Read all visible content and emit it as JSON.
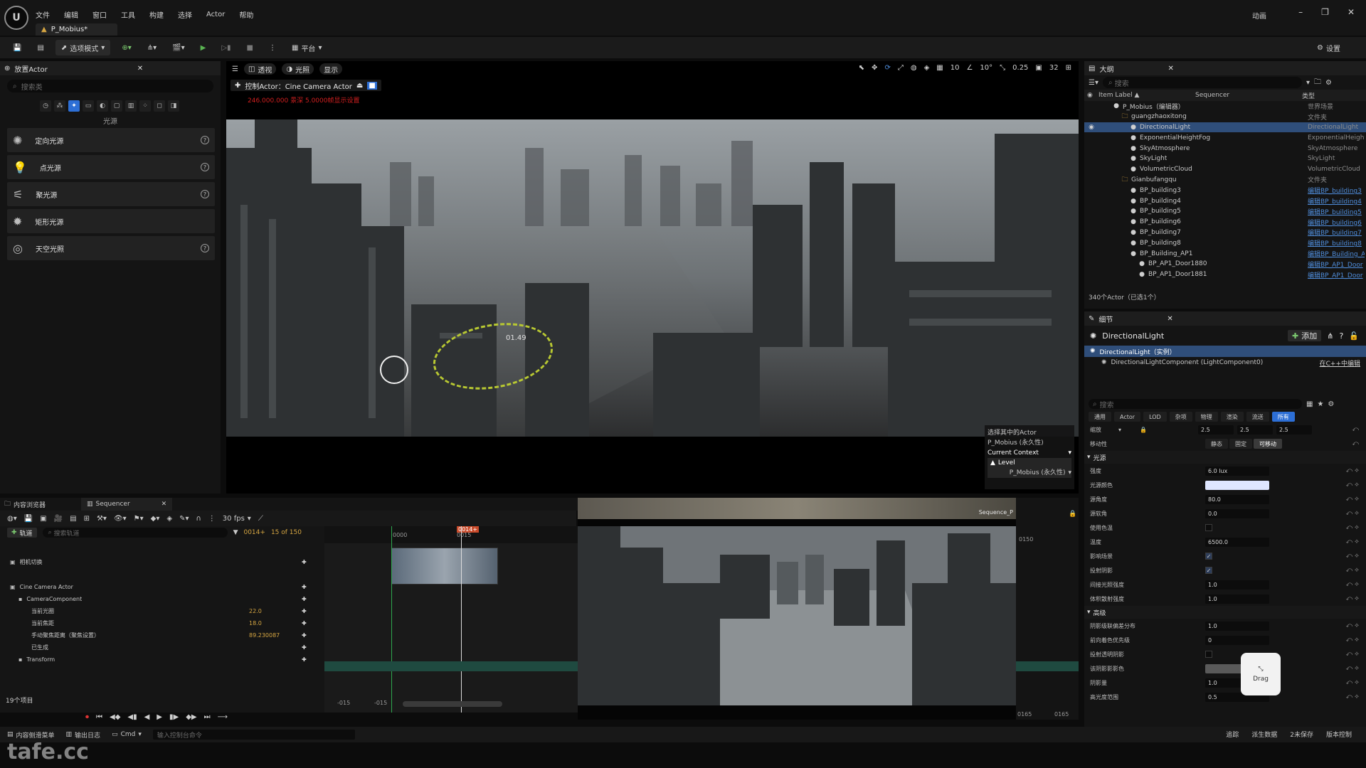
{
  "titlebar": {
    "menus": [
      "文件",
      "编辑",
      "窗口",
      "工具",
      "构建",
      "选择",
      "Actor",
      "帮助"
    ],
    "doc_tab": "P_Mobius*",
    "anim_label": "动画"
  },
  "toolbar": {
    "mode_label": "选项模式",
    "platform_label": "平台",
    "settings_label": "设置"
  },
  "place_actor": {
    "tab_label": "放置Actor",
    "search_placeholder": "搜索类",
    "category_label": "光源",
    "items": [
      {
        "label": "定向光源"
      },
      {
        "label": "点光源"
      },
      {
        "label": "聚光源"
      },
      {
        "label": "矩形光源"
      },
      {
        "label": "天空光照"
      }
    ]
  },
  "viewport": {
    "pills": [
      "透视",
      "光照",
      "显示"
    ],
    "grid_snap": "10",
    "rot_snap": "10°",
    "scale_snap": "0.25",
    "cam_speed": "32",
    "pilot_label": "控制Actor：Cine Camera Actor",
    "pilot_warning": "246.000.000 景深  5.0000帧显示设置",
    "fov_readout": "01.49",
    "context": {
      "title": "选择其中的Actor",
      "actor": "P_Mobius (永久性)",
      "section": "Current Context",
      "level_label": "Level",
      "level_value": "P_Mobius (永久性)"
    }
  },
  "outliner": {
    "tab_label": "大纲",
    "search_placeholder": "搜索",
    "col_label": "Item Label ▲",
    "col_sequencer": "Sequencer",
    "col_type": "类型",
    "rows": [
      {
        "label": "P_Mobius（编辑器）",
        "type": "世界场景",
        "indent": 1,
        "link": false,
        "selected": false
      },
      {
        "label": "guangzhaoxitong",
        "type": "文件夹",
        "indent": 2,
        "link": false,
        "selected": false
      },
      {
        "label": "DirectionalLight",
        "type": "DirectionalLight",
        "indent": 3,
        "link": false,
        "selected": true
      },
      {
        "label": "ExponentialHeightFog",
        "type": "ExponentialHeightFog",
        "indent": 3,
        "link": false,
        "selected": false
      },
      {
        "label": "SkyAtmosphere",
        "type": "SkyAtmosphere",
        "indent": 3,
        "link": false,
        "selected": false
      },
      {
        "label": "SkyLight",
        "type": "SkyLight",
        "indent": 3,
        "link": false,
        "selected": false
      },
      {
        "label": "VolumetricCloud",
        "type": "VolumetricCloud",
        "indent": 3,
        "link": false,
        "selected": false
      },
      {
        "label": "Gianbufangqu",
        "type": "文件夹",
        "indent": 2,
        "link": false,
        "selected": false
      },
      {
        "label": "BP_building3",
        "type": "编辑BP_building3",
        "indent": 3,
        "link": true,
        "selected": false
      },
      {
        "label": "BP_building4",
        "type": "编辑BP_building4",
        "indent": 3,
        "link": true,
        "selected": false
      },
      {
        "label": "BP_building5",
        "type": "编辑BP_building5",
        "indent": 3,
        "link": true,
        "selected": false
      },
      {
        "label": "BP_building6",
        "type": "编辑BP_building6",
        "indent": 3,
        "link": true,
        "selected": false
      },
      {
        "label": "BP_building7",
        "type": "编辑BP_building7",
        "indent": 3,
        "link": true,
        "selected": false
      },
      {
        "label": "BP_building8",
        "type": "编辑BP_building8",
        "indent": 3,
        "link": true,
        "selected": false
      },
      {
        "label": "BP_Building_AP1",
        "type": "编辑BP_Building_AP1",
        "indent": 3,
        "link": true,
        "selected": false
      },
      {
        "label": "BP_AP1_Door1880",
        "type": "编辑BP_AP1_Door",
        "indent": 4,
        "link": true,
        "selected": false
      },
      {
        "label": "BP_AP1_Door1881",
        "type": "编辑BP_AP1_Door",
        "indent": 4,
        "link": true,
        "selected": false
      }
    ],
    "count": "340个Actor（已选1个）"
  },
  "details": {
    "tab_label": "细节",
    "actor_name": "DirectionalLight",
    "add_label": "添加",
    "component_root": "DirectionalLight（实例）",
    "component_child": "DirectionalLightComponent (LightComponent0)",
    "edit_cpp": "在C++中编辑",
    "search_placeholder": "搜索",
    "tabs": [
      "通用",
      "Actor",
      "LOD",
      "杂项",
      "物理",
      "渲染",
      "流送",
      "所有"
    ],
    "active_tab": "所有",
    "scale_label": "缩放",
    "scale_values": [
      "2.5",
      "2.5",
      "2.5"
    ],
    "mobility_label": "移动性",
    "mobility_options": [
      "静态",
      "固定",
      "可移动"
    ],
    "section_light": "光源",
    "rows_light": [
      {
        "name": "强度",
        "kind": "input",
        "value": "6.0 lux"
      },
      {
        "name": "光源颜色",
        "kind": "color",
        "value": ""
      },
      {
        "name": "源角度",
        "kind": "input",
        "value": "80.0"
      },
      {
        "name": "源软角",
        "kind": "input",
        "value": "0.0"
      },
      {
        "name": "使用色温",
        "kind": "check",
        "value": ""
      },
      {
        "name": "温度",
        "kind": "input",
        "value": "6500.0"
      },
      {
        "name": "影响场景",
        "kind": "check",
        "value": "✓"
      },
      {
        "name": "投射阴影",
        "kind": "check",
        "value": "✓"
      },
      {
        "name": "间接光照强度",
        "kind": "input",
        "value": "1.0"
      },
      {
        "name": "体积散射强度",
        "kind": "input",
        "value": "1.0"
      }
    ],
    "section_advanced": "高级",
    "rows_advanced": [
      {
        "name": "阴影级联偏差分布",
        "kind": "input",
        "value": "1.0"
      },
      {
        "name": "前向着色优先级",
        "kind": "input",
        "value": "0"
      },
      {
        "name": "投射透明阴影",
        "kind": "check",
        "value": ""
      },
      {
        "name": "该阴影影影色",
        "kind": "color2",
        "value": ""
      },
      {
        "name": "阴影量",
        "kind": "input",
        "value": "1.0"
      },
      {
        "name": "高光度范围",
        "kind": "input",
        "value": "0.5"
      }
    ],
    "drag_label": "Drag"
  },
  "bottom": {
    "content_browser_tab": "内容浏览器",
    "sequencer_tab": "Sequencer",
    "fps_label": "30 fps",
    "add_track": "轨道",
    "search_placeholder": "搜索轨道",
    "frame_current": "0014+",
    "frame_of": "15 of 150",
    "tracks": [
      {
        "label": "相机切换",
        "value": "",
        "indent": 0
      },
      {
        "label": "Cine Camera Actor",
        "value": "",
        "indent": 0
      },
      {
        "label": "CameraComponent",
        "value": "",
        "indent": 1
      },
      {
        "label": "当前光圈",
        "value": "22.0",
        "indent": 2
      },
      {
        "label": "当前焦距",
        "value": "18.0",
        "indent": 2
      },
      {
        "label": "手动聚焦距离（聚焦设置）",
        "value": "89.230087",
        "indent": 2
      },
      {
        "label": "已生成",
        "value": "",
        "indent": 2
      },
      {
        "label": "Transform",
        "value": "",
        "indent": 1
      }
    ],
    "item_count": "19个项目",
    "timeline_start": "-015",
    "timeline_start2": "-015",
    "timeline_marks": [
      "0000",
      "0015"
    ],
    "playhead": "0014+",
    "right_start": "0150",
    "right_end": "0165",
    "right_end2": "0165",
    "sequence_name": "Sequence_P"
  },
  "statusbar": {
    "items": [
      "内容侧滑菜单",
      "输出日志",
      "Cmd"
    ],
    "cmd_placeholder": "输入控制台命令",
    "right_items": [
      "追踪",
      "派生数据",
      "2未保存",
      "版本控制"
    ]
  },
  "watermark": "tafe.cc"
}
